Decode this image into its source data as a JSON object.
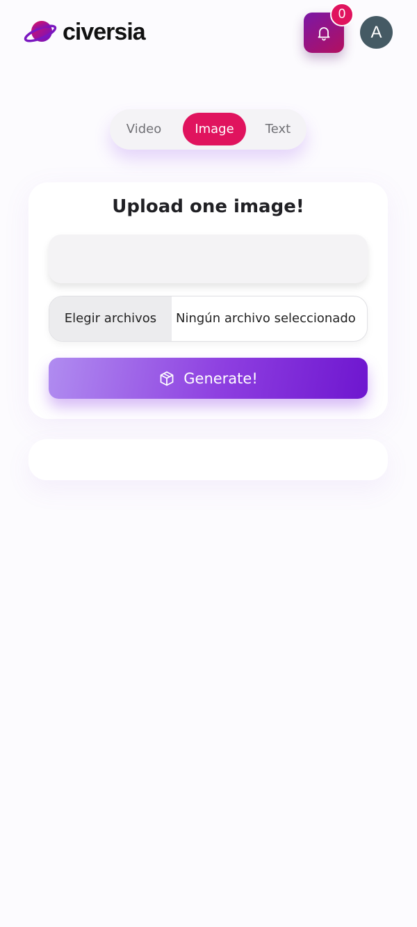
{
  "header": {
    "brand": "civersia",
    "brand_colors": [
      "#7a17a6",
      "#e0135e"
    ],
    "notification_icon": "bell-icon",
    "notification_count": "0",
    "avatar_initial": "A"
  },
  "tabs": [
    {
      "label": "Video",
      "active": false
    },
    {
      "label": "Image",
      "active": true
    },
    {
      "label": "Text",
      "active": false
    }
  ],
  "upload_card": {
    "title": "Upload one image!",
    "prompt_value": "",
    "file_button_label": "Elegir archivos",
    "file_status": "Ningún archivo seleccionado",
    "generate_label": "Generate!",
    "generate_icon": "cube-icon"
  },
  "colors": {
    "accent_pink": "#e0135e",
    "accent_purple": "#6e16cf"
  }
}
